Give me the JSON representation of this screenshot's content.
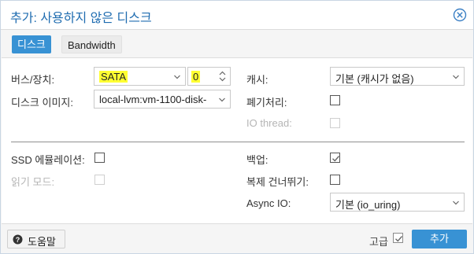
{
  "dialog": {
    "title": "추가: 사용하지 않은 디스크"
  },
  "tabs": [
    {
      "label": "디스크",
      "active": true
    },
    {
      "label": "Bandwidth",
      "active": false
    }
  ],
  "form": {
    "bus_device": {
      "label": "버스/장치:",
      "bus_value": "SATA",
      "device_value": "0"
    },
    "disk_image": {
      "label": "디스크 이미지:",
      "value": "local-lvm:vm-1100-disk-"
    },
    "cache": {
      "label": "캐시:",
      "value": "기본 (캐시가 없음)"
    },
    "discard": {
      "label": "폐기처리:",
      "checked": false
    },
    "io_thread": {
      "label": "IO thread:",
      "checked": false,
      "disabled": true
    },
    "ssd_emulation": {
      "label": "SSD 에뮬레이션:",
      "checked": false
    },
    "read_only": {
      "label": "읽기 모드:",
      "checked": false,
      "disabled": true
    },
    "backup": {
      "label": "백업:",
      "checked": true
    },
    "skip_replication": {
      "label": "복제 건너뛰기:",
      "checked": false
    },
    "async_io": {
      "label": "Async IO:",
      "value": "기본 (io_uring)"
    }
  },
  "footer": {
    "help_label": "도움말",
    "advanced_label": "고급",
    "advanced_checked": true,
    "add_label": "추가"
  },
  "colors": {
    "accent": "#3892d4",
    "title": "#1f6cb0",
    "highlight": "#ffff33"
  }
}
